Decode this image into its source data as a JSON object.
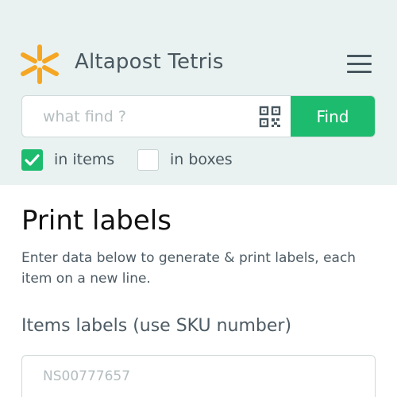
{
  "header": {
    "app_title": "Altapost Tetris",
    "logo_icon": "asterisk-logo-icon",
    "menu_icon": "hamburger-menu-icon",
    "logo_color": "#f5a623",
    "background": "#e9f2f1"
  },
  "search": {
    "placeholder": "what find ?",
    "value": "",
    "qr_icon": "qr-code-icon",
    "find_label": "Find",
    "button_color": "#1dbb6e"
  },
  "filters": {
    "in_items": {
      "label": "in items",
      "checked": true
    },
    "in_boxes": {
      "label": "in boxes",
      "checked": false
    }
  },
  "main": {
    "title": "Print labels",
    "description": "Enter data below to generate & print labels, each item on a new line.",
    "items_section_label": "Items labels (use SKU number)",
    "items_placeholder": "NS00777657",
    "items_value": ""
  }
}
